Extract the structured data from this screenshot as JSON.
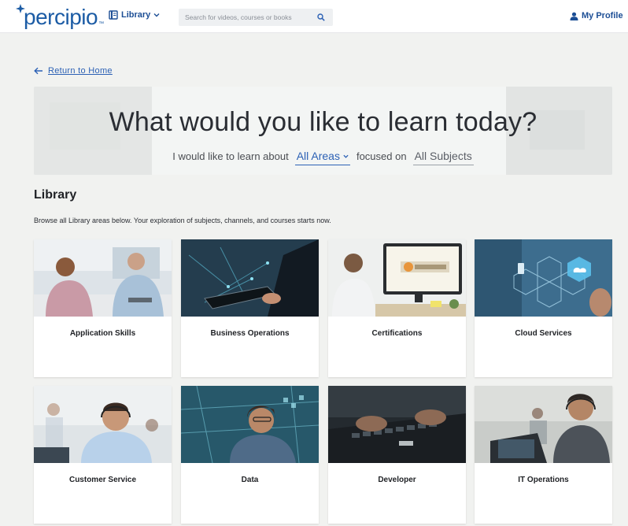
{
  "header": {
    "logo_text": "percipio",
    "logo_tm": "™",
    "library_label": "Library",
    "search_placeholder": "Search for videos, courses or books",
    "profile_label": "My Profile"
  },
  "back_link": {
    "label": "Return to Home"
  },
  "hero": {
    "title": "What would you like to learn today?",
    "prompt": "I would like to learn about",
    "areas_value": "All Areas",
    "focused_on": "focused on",
    "subjects_value": "All Subjects"
  },
  "library": {
    "title": "Library",
    "description": "Browse all Library areas below. Your exploration of subjects, channels, and courses starts now."
  },
  "cards": [
    {
      "label": "Application Skills",
      "theme": "office-meeting"
    },
    {
      "label": "Business Operations",
      "theme": "tablet-network"
    },
    {
      "label": "Certifications",
      "theme": "certification-monitor"
    },
    {
      "label": "Cloud Services",
      "theme": "cloud-hexagons"
    },
    {
      "label": "Customer Service",
      "theme": "headset-agent"
    },
    {
      "label": "Data",
      "theme": "data-screen"
    },
    {
      "label": "Developer",
      "theme": "keyboard-code"
    },
    {
      "label": "IT Operations",
      "theme": "support-desk"
    }
  ],
  "colors": {
    "brand": "#1c5ca5",
    "link": "#2c61b5",
    "page_bg": "#f1f2f0"
  }
}
